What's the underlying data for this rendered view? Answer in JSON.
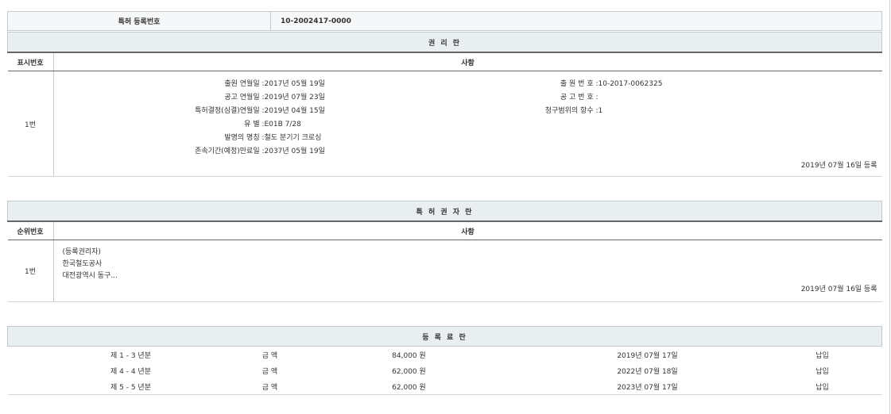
{
  "registration": {
    "label": "특허 등록번호",
    "value": "10-2002417-0000"
  },
  "rights": {
    "section_title": "권 리 란",
    "col_num": "표시번호",
    "col_content": "사항",
    "row_num": "1번",
    "left_fields": [
      {
        "label": "출원 연월일 : ",
        "value": "2017년 05월 19일"
      },
      {
        "label": "공고 연월일 : ",
        "value": "2019년 07월 23일"
      },
      {
        "label": "특허결정(심결)연월일 : ",
        "value": "2019년 04월 15일"
      },
      {
        "label": "유 별 : ",
        "value": "E01B 7/28"
      },
      {
        "label": "발명의 명칭 : ",
        "value": "철도 분기기 크로싱"
      },
      {
        "label": "존속기간(예정)만료일 : ",
        "value": "2037년 05월 19일"
      }
    ],
    "right_fields": [
      {
        "label": "출 원 번 호 : ",
        "value": "10-2017-0062325"
      },
      {
        "label": "공 고 번 호 : ",
        "value": ""
      },
      {
        "label": "청구범위의 항수 : ",
        "value": "1"
      }
    ],
    "registered": "2019년 07월 16일 등록"
  },
  "owner": {
    "section_title": "특 허 권 자 란",
    "col_num": "순위번호",
    "col_content": "사항",
    "row_num": "1번",
    "lines": [
      "(등록권리자)",
      "한국철도공사",
      "대전광역시 동구..."
    ],
    "registered": "2019년 07월 16일 등록"
  },
  "fees": {
    "section_title": "등 록 료 란",
    "rows": [
      {
        "period": "제 1 - 3 년분",
        "amount_label": "금 액",
        "amount": "84,000 원",
        "date": "2019년 07월 17일",
        "status": "납입"
      },
      {
        "period": "제 4 - 4 년분",
        "amount_label": "금 액",
        "amount": "62,000 원",
        "date": "2022년 07월 18일",
        "status": "납입"
      },
      {
        "period": "제 5 - 5 년분",
        "amount_label": "금 액",
        "amount": "62,000 원",
        "date": "2023년 07월 17일",
        "status": "납입"
      }
    ]
  }
}
